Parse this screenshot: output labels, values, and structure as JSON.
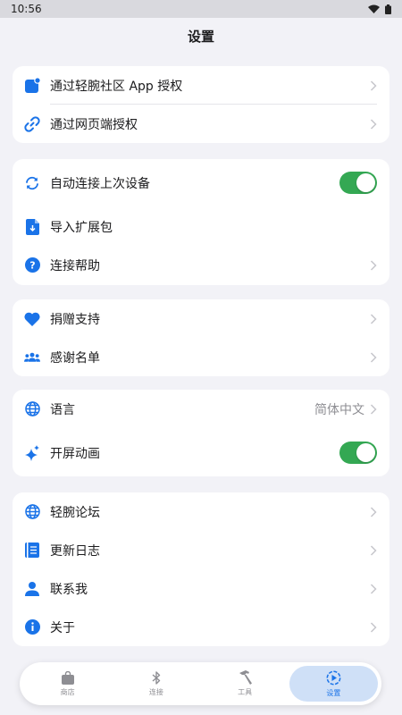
{
  "status_bar": {
    "time": "10:56"
  },
  "page": {
    "title": "设置"
  },
  "groups": [
    {
      "items": [
        {
          "label": "通过轻腕社区 App 授权",
          "icon": "app-badge-icon"
        },
        {
          "label": "通过网页端授权",
          "icon": "link-icon"
        }
      ]
    },
    {
      "items": [
        {
          "label": "自动连接上次设备",
          "icon": "sync-icon",
          "toggle": true
        },
        {
          "label": "导入扩展包",
          "icon": "file-import-icon"
        },
        {
          "label": "连接帮助",
          "icon": "help-icon"
        }
      ]
    },
    {
      "items": [
        {
          "label": "捐赠支持",
          "icon": "heart-icon"
        },
        {
          "label": "感谢名单",
          "icon": "people-icon"
        }
      ]
    },
    {
      "items": [
        {
          "label": "语言",
          "icon": "globe-icon",
          "value": "简体中文"
        },
        {
          "label": "开屏动画",
          "icon": "sparkle-icon",
          "toggle": true
        }
      ]
    },
    {
      "items": [
        {
          "label": "轻腕论坛",
          "icon": "globe-icon"
        },
        {
          "label": "更新日志",
          "icon": "book-icon"
        },
        {
          "label": "联系我",
          "icon": "person-icon"
        },
        {
          "label": "关于",
          "icon": "info-icon"
        }
      ]
    }
  ],
  "tabbar": [
    {
      "label": "商店",
      "icon": "bag-icon",
      "active": false
    },
    {
      "label": "连接",
      "icon": "bluetooth-icon",
      "active": false
    },
    {
      "label": "工具",
      "icon": "hammer-icon",
      "active": false
    },
    {
      "label": "设置",
      "icon": "settings-icon",
      "active": true
    }
  ],
  "colors": {
    "accent": "#1a73e8",
    "toggle_on": "#34a853",
    "background": "#f2f2f7"
  }
}
